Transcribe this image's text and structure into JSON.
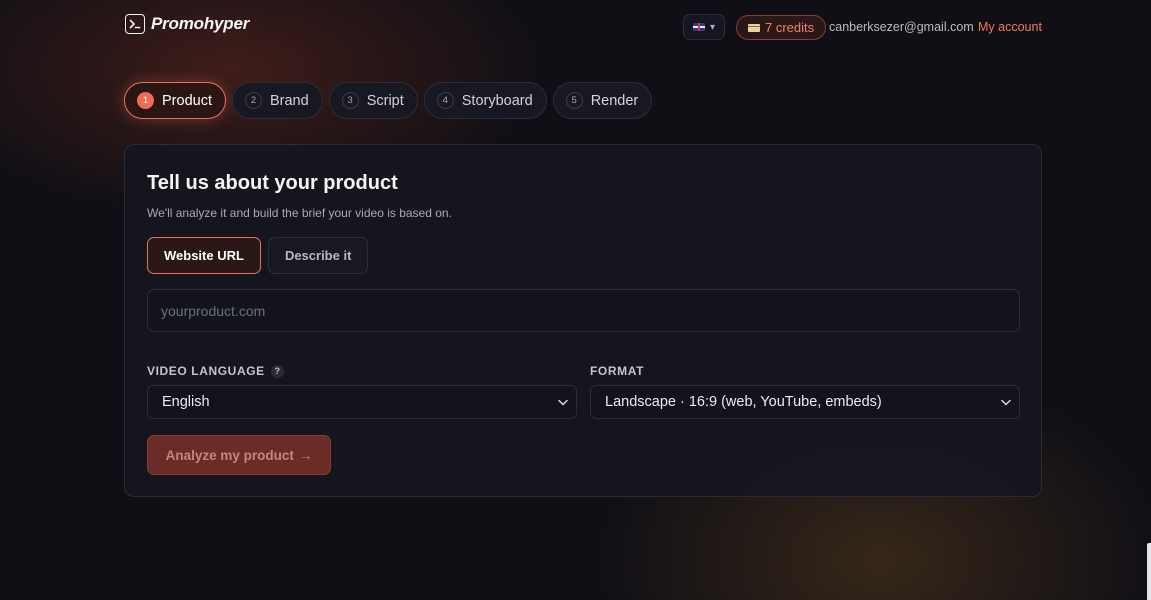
{
  "header": {
    "brand_name": "Promohyper",
    "brand_icon": "terminal-icon",
    "language_flag": "uk-flag-icon",
    "language_caret": "▾",
    "credits_label": "7 credits",
    "credits_icon": "credit-card-icon",
    "email": "canberksezer@gmail.com",
    "account_link": "My account"
  },
  "steps": [
    {
      "number": "1",
      "label": "Product",
      "active": true
    },
    {
      "number": "2",
      "label": "Brand",
      "active": false
    },
    {
      "number": "3",
      "label": "Script",
      "active": false
    },
    {
      "number": "4",
      "label": "Storyboard",
      "active": false
    },
    {
      "number": "5",
      "label": "Render",
      "active": false
    }
  ],
  "panel": {
    "title": "Tell us about your product",
    "subtitle": "We'll analyze it and build the brief your video is based on.",
    "mode_tabs": [
      {
        "label": "Website URL",
        "active": true
      },
      {
        "label": "Describe it",
        "active": false
      }
    ],
    "url_input": {
      "value": "",
      "placeholder": "yourproduct.com"
    },
    "video_language": {
      "label": "VIDEO LANGUAGE",
      "help": "?",
      "selected": "English"
    },
    "format": {
      "label": "FORMAT",
      "selected": "Landscape · 16:9 (web, YouTube, embeds)"
    },
    "analyze_button": "Analyze my product",
    "analyze_arrow": "→",
    "analyze_enabled": false
  },
  "colors": {
    "accent": "#ee6c55",
    "accent_text": "#f07a5f",
    "background": "#100f15",
    "panel": "#16161f"
  }
}
